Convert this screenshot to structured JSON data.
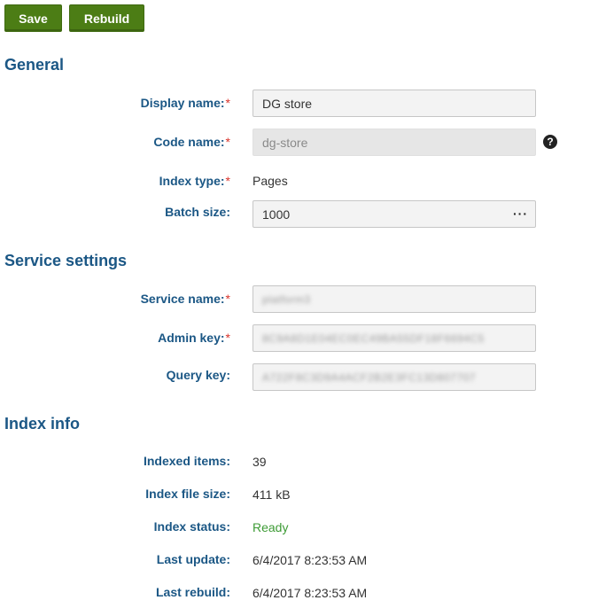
{
  "toolbar": {
    "save_label": "Save",
    "rebuild_label": "Rebuild"
  },
  "sections": {
    "general": "General",
    "service": "Service settings",
    "index_info": "Index info"
  },
  "general": {
    "display_name_label": "Display name:",
    "display_name_value": "DG store",
    "code_name_label": "Code name:",
    "code_name_value": "dg-store",
    "index_type_label": "Index type:",
    "index_type_value": "Pages",
    "batch_size_label": "Batch size:",
    "batch_size_value": "1000",
    "more_glyph": "···",
    "help_glyph": "?"
  },
  "service": {
    "service_name_label": "Service name:",
    "service_name_value": "platform3",
    "admin_key_label": "Admin key:",
    "admin_key_value": "8C9A8D1E04EC0EC49BA55DF18F6694C5",
    "query_key_label": "Query key:",
    "query_key_value": "A722F8C3D9A4ACF2B2E3FC13D807707"
  },
  "index_info": {
    "indexed_items_label": "Indexed items:",
    "indexed_items_value": "39",
    "file_size_label": "Index file size:",
    "file_size_value": "411 kB",
    "status_label": "Index status:",
    "status_value": "Ready",
    "last_update_label": "Last update:",
    "last_update_value": "6/4/2017 8:23:53 AM",
    "last_rebuild_label": "Last rebuild:",
    "last_rebuild_value": "6/4/2017 8:23:53 AM"
  },
  "required_marker": "*",
  "colors": {
    "button_green": "#4c7d15",
    "heading_blue": "#1b5785",
    "required_red": "#d9342b",
    "status_green": "#3d9b35"
  }
}
